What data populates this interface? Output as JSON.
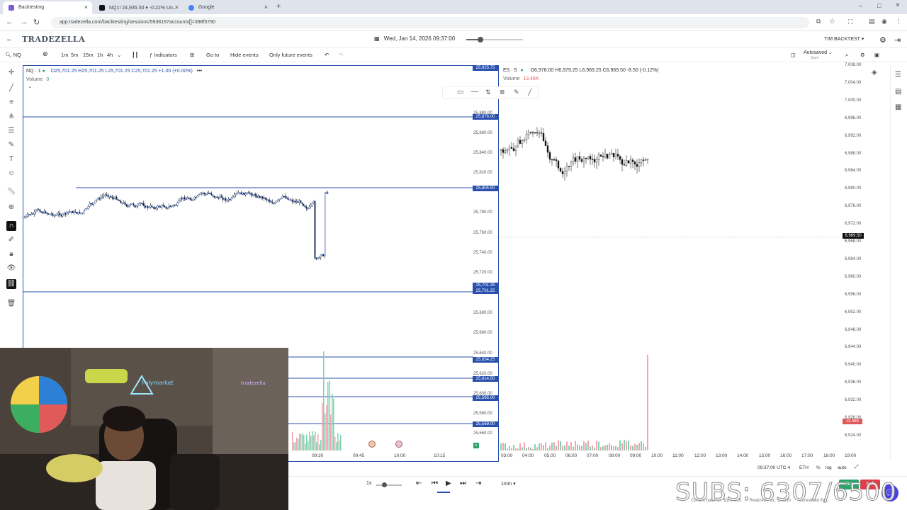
{
  "browser": {
    "tabs": [
      {
        "label": "Backtesting",
        "active": true
      },
      {
        "label": "NQ1! 24,935.50 ▾ -0.22% Un...",
        "active": false
      },
      {
        "label": "Google",
        "active": false
      }
    ],
    "url": "app.tradezella.com/backtesting/sessions/5938197accounts[]=398f5790"
  },
  "app": {
    "logo": "TRADEZELLA",
    "date_time": "Wed, Jan 14, 2026 09:37:00",
    "account": "TIM BACKTEST",
    "autosaved": "Autosaved",
    "autosaved_sub": "Save"
  },
  "toolbar": {
    "symbol": "NQ",
    "timeframes": [
      "1m",
      "5m",
      "15m",
      "1h",
      "4h"
    ],
    "indicators": "Indicators",
    "goto": "Go to",
    "hide_events": "Hide events",
    "future_events": "Only future events"
  },
  "chart_left": {
    "symbol": "NQ · 1",
    "ohlc": "O25,701.25 H25,701.25 L25,701.25 C25,701.25 +1.00 (+0.00%)",
    "volume_label": "Volume",
    "volume_value": "0",
    "price_labels": [
      "25,880.00",
      "25,860.00",
      "25,840.00",
      "25,820.00",
      "25,780.00",
      "25,760.00",
      "25,740.00",
      "25,720.00",
      "25,680.00",
      "25,660.00",
      "25,640.00",
      "25,620.00",
      "25,600.00",
      "25,580.00",
      "25,560.00"
    ],
    "price_badges": [
      "25,925.75",
      "25,876.00",
      "25,805.50",
      "25,701.25",
      "25,701.25",
      "25,634.25",
      "25,614.50",
      "25,595.00",
      "25,569.00"
    ],
    "time_labels": [
      "09:30",
      "09:45",
      "10:00",
      "10:15"
    ]
  },
  "chart_right": {
    "symbol": "ES · 5",
    "ohlc": "O6,978.00 H6,979.25 L6,969.25 C6,969.50 -8.50 (-0.12%)",
    "volume_label": "Volume",
    "volume_value": "13.46K",
    "price_labels": [
      "7,008.00",
      "7,004.00",
      "7,000.00",
      "6,996.00",
      "6,992.00",
      "6,988.00",
      "6,984.00",
      "6,980.00",
      "6,976.00",
      "6,972.00",
      "6,968.00",
      "6,964.00",
      "6,960.00",
      "6,956.00",
      "6,952.00",
      "6,948.00",
      "6,944.00",
      "6,940.00",
      "6,936.00",
      "6,932.00",
      "6,928.00",
      "6,924.00"
    ],
    "current_price": "6,969.50",
    "volume_badge": "13.46K",
    "time_labels": [
      "03:00",
      "04:00",
      "05:00",
      "06:00",
      "07:00",
      "08:00",
      "09:00",
      "10:00",
      "11:00",
      "12:00",
      "13:00",
      "14:00",
      "15:00",
      "16:00",
      "17:00",
      "18:00",
      "19:00"
    ],
    "timezone": "09:37:00 UTC-4",
    "session": "ETH",
    "pct": "%",
    "log": "log",
    "auto": "auto"
  },
  "playback": {
    "speed": "1x",
    "interval": "1min"
  },
  "footer": {
    "current_balance": "Current balance: $107,880",
    "realized": "Realized P&L: $7,880",
    "unrealized": "Unrealized P&L:",
    "buy": "Buy",
    "sell": "Sell"
  },
  "overlay": {
    "subs": "SUBS: 6307/6500"
  },
  "colors": {
    "accent": "#2950ad",
    "candle_up": "#ffffff",
    "candle_down": "#111111",
    "vol_up": "#7fd3b0",
    "vol_down": "#f3a3b1"
  }
}
